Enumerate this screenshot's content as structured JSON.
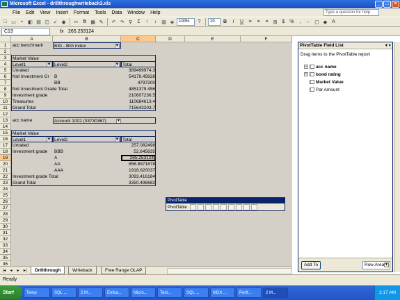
{
  "window": {
    "title": "Microsoft Excel - drillthroughwriteback3.xls"
  },
  "menu": [
    "File",
    "Edit",
    "View",
    "Insert",
    "Format",
    "Tools",
    "Data",
    "Window",
    "Help"
  ],
  "help_box": {
    "placeholder": "Type a question for help"
  },
  "toolbar": {
    "zoom": "100%",
    "font_size": "10"
  },
  "formula_bar": {
    "cell_ref": "C19",
    "fx": "fx",
    "value": "265.253124"
  },
  "columns": [
    "A",
    "B",
    "C",
    "D",
    "E",
    "F",
    "G",
    "H"
  ],
  "rows": [
    "1",
    "2",
    "3",
    "4",
    "5",
    "6",
    "7",
    "8",
    "9",
    "10",
    "11",
    "12",
    "13",
    "14",
    "15",
    "16",
    "17",
    "18",
    "19",
    "20",
    "21",
    "22",
    "23",
    "24",
    "25",
    "26",
    "27",
    "28",
    "29",
    "30",
    "31",
    "32",
    "33",
    "34",
    "35",
    "36"
  ],
  "pivot1": {
    "filter_label": "acc benchmark",
    "filter_value": "BIG    - BIG index",
    "data_field": "Market Value",
    "level1": "Level1",
    "level2": "Level2",
    "total": "Total",
    "r5": {
      "a": "Unrated",
      "b": "",
      "c": "389499974.3"
    },
    "r6": {
      "a": "Not Investment Gr",
      "b": "B",
      "c": "54179.45628"
    },
    "r7": {
      "a": "",
      "b": "BB",
      "c": "4797200"
    },
    "r8": {
      "a": "Not Investment Grade Total",
      "c": "4851379.456"
    },
    "r9": {
      "a": "Investment grade",
      "c": "210607236.5"
    },
    "r10": {
      "a": "Treasuries",
      "c": "110684613.4"
    },
    "r11": {
      "a": "Grand Total",
      "c": "715643203.7"
    }
  },
  "pivot2": {
    "filter_label": "acc name",
    "filter_value": "Account 1002 (03730367)",
    "data_field": "Market Value",
    "level1": "Level1",
    "level2": "Level2",
    "total": "Total",
    "r17": {
      "a": "Unrated",
      "b": "",
      "c": "257.082498"
    },
    "r18": {
      "a": "Investment grade",
      "b": "BBB",
      "c": "52.645835"
    },
    "r19": {
      "a": "",
      "b": "A",
      "c": "265.253124"
    },
    "r20": {
      "a": "",
      "b": "AA",
      "c": "856.8971878"
    },
    "r21": {
      "a": "",
      "b": "AAA",
      "c": "1918.620037"
    },
    "r22": {
      "a": "Investment grade Total",
      "c": "3093.416184"
    },
    "r23": {
      "a": "Grand Total",
      "c": "3350.498682"
    }
  },
  "sheet_tabs": [
    "Drillthrough",
    "Writeback",
    "Free Range OLAP"
  ],
  "status": "Ready",
  "field_list": {
    "title": "PivotTable Field List",
    "subtitle": "Drag items to the PivotTable report",
    "items": [
      "acc name",
      "bond rating",
      "Market Value",
      "Par Amount"
    ],
    "add_to": "Add To",
    "area": "Row Area"
  },
  "pivot_toolbar": {
    "title": "PivotTable",
    "menu": "PivotTable"
  },
  "taskbar": {
    "start": "Start",
    "tasks": [
      "Temp",
      "SQL ...",
      "2 M...",
      "Emba...",
      "Micro...",
      "Text...",
      "SQL ...",
      "MDX ...",
      "Portf...",
      "2 M..."
    ],
    "clock": "2:17 AM"
  }
}
